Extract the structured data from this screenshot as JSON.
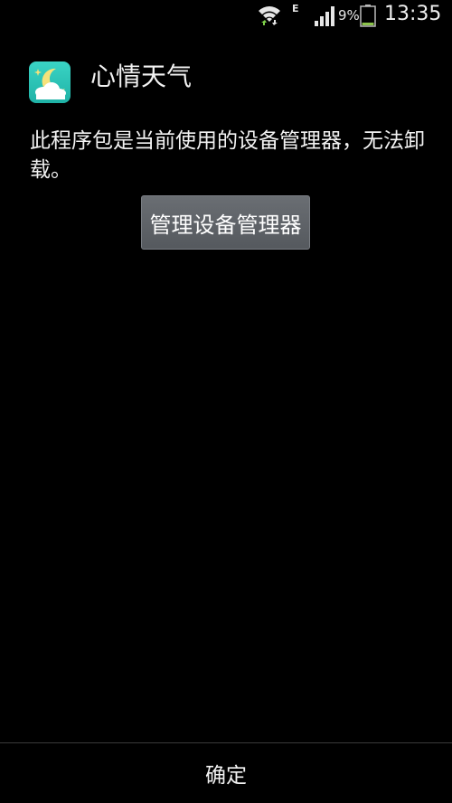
{
  "status_bar": {
    "network_type": "E",
    "battery_percent": "9%",
    "time": "13:35",
    "icons": [
      "wifi-icon",
      "signal-icon",
      "battery-icon"
    ]
  },
  "dialog": {
    "app_name": "心情天气",
    "message": "此程序包是当前使用的设备管理器，无法卸载。",
    "manage_button_label": "管理设备管理器",
    "ok_button_label": "确定"
  },
  "colors": {
    "background": "#000000",
    "button_gray": "#5f6368",
    "app_icon_teal": "#2ec4b6"
  }
}
